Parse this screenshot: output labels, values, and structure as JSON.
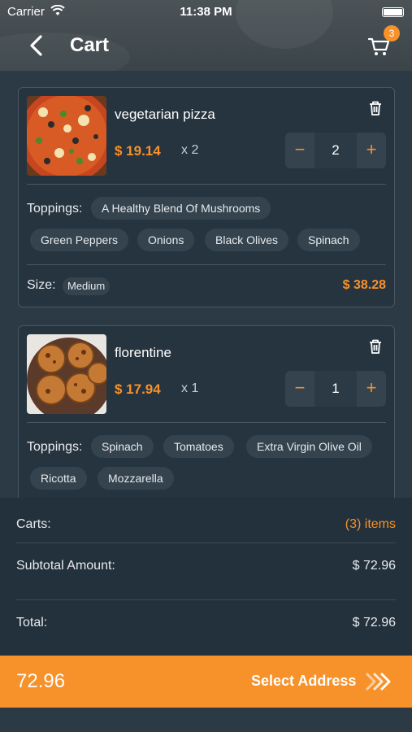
{
  "status_bar": {
    "carrier": "Carrier",
    "time": "11:38 PM"
  },
  "header": {
    "title": "Cart",
    "cart_count": "3"
  },
  "items": [
    {
      "name": "vegetarian pizza",
      "price": "$ 19.14",
      "qty_label": "x 2",
      "quantity": "2",
      "toppings_label": "Toppings:",
      "toppings": [
        "A Healthy Blend Of Mushrooms",
        "Green Peppers",
        "Onions",
        "Black Olives",
        "Spinach"
      ],
      "size_label": "Size:",
      "size": "Medium",
      "line_total": "$ 38.28"
    },
    {
      "name": "florentine",
      "price": "$ 17.94",
      "qty_label": "x 1",
      "quantity": "1",
      "toppings_label": "Toppings:",
      "toppings": [
        "Spinach",
        "Tomatoes",
        "Extra Virgin Olive Oil",
        "Ricotta",
        "Mozzarella"
      ]
    }
  ],
  "stepper": {
    "minus": "−",
    "plus": "+"
  },
  "summary": {
    "carts_label": "Carts:",
    "carts_value": "(3) items",
    "subtotal_label": "Subtotal Amount:",
    "subtotal_value": "$ 72.96",
    "total_label": "Total:",
    "total_value": "$ 72.96"
  },
  "footer": {
    "amount": "72.96",
    "cta": "Select Address"
  },
  "colors": {
    "accent": "#f7912a",
    "background": "#2b3a45",
    "card": "#26343f"
  },
  "icons": [
    "back-chevron-icon",
    "cart-icon",
    "trash-icon",
    "double-chevron-right-icon",
    "wifi-icon",
    "battery-icon"
  ]
}
